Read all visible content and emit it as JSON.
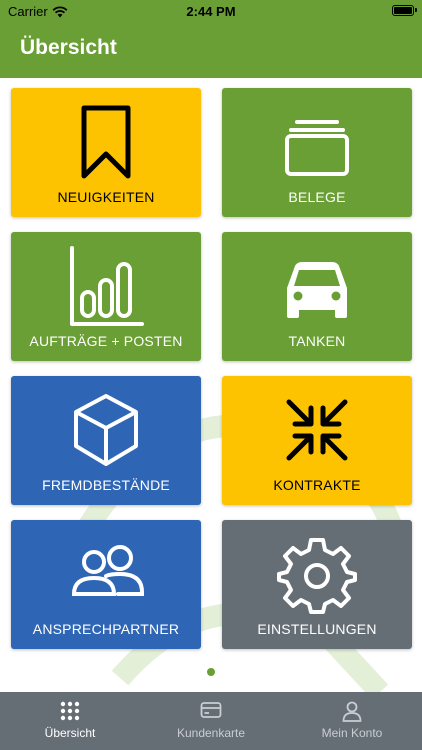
{
  "status_bar": {
    "carrier": "Carrier",
    "time": "2:44 PM"
  },
  "header": {
    "title": "Übersicht"
  },
  "colors": {
    "brand_green": "#6a9f35",
    "tile_yellow": "#fdc300",
    "tile_green": "#6a9f35",
    "tile_blue": "#2e66b5",
    "tile_gray": "#666e75",
    "tab_bar": "#656d75",
    "tab_active_text": "#ffffff",
    "tab_inactive_text": "#c9ced3"
  },
  "tiles": [
    {
      "label": "NEUIGKEITEN",
      "icon": "bookmark-icon",
      "color": "yellow"
    },
    {
      "label": "BELEGE",
      "icon": "stacked-cards-icon",
      "color": "green"
    },
    {
      "label": "AUFTRÄGE + POSTEN",
      "icon": "bar-chart-icon",
      "color": "green"
    },
    {
      "label": "TANKEN",
      "icon": "car-icon",
      "color": "green"
    },
    {
      "label": "FREMDBESTÄNDE",
      "icon": "cube-icon",
      "color": "blue"
    },
    {
      "label": "KONTRAKTE",
      "icon": "compress-arrows-icon",
      "color": "yellow"
    },
    {
      "label": "ANSPRECHPARTNER",
      "icon": "contacts-icon",
      "color": "blue"
    },
    {
      "label": "EINSTELLUNGEN",
      "icon": "gear-icon",
      "color": "gray"
    }
  ],
  "pager": {
    "current_page": 1
  },
  "tab_bar": {
    "items": [
      {
        "label": "Übersicht",
        "icon": "grid-dots-icon",
        "active": true
      },
      {
        "label": "Kundenkarte",
        "icon": "card-icon",
        "active": false
      },
      {
        "label": "Mein Konto",
        "icon": "person-icon",
        "active": false
      }
    ]
  }
}
